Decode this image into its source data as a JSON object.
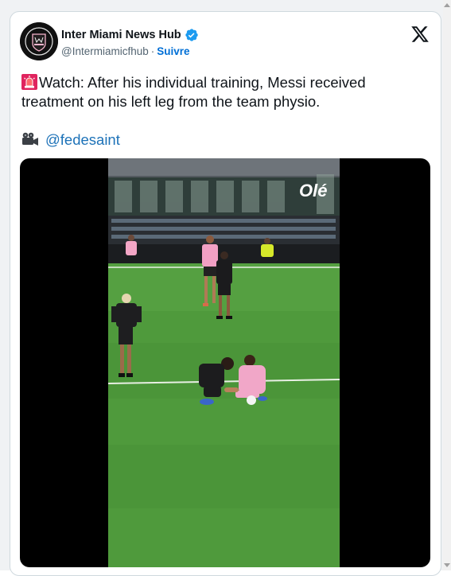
{
  "tweet": {
    "author": {
      "display_name": "Inter Miami News Hub",
      "handle": "@Intermiamicfhub",
      "separator": "·",
      "follow_label": "Suivre",
      "verified": true
    },
    "text": "Watch: After his individual training, Messi received treatment on his left leg from the team physio.",
    "credit_mention": "@fedesaint",
    "icons": {
      "lead": "siren-icon",
      "credit": "movie-camera-icon",
      "brand": "x-logo-icon",
      "badge": "verified-badge-icon"
    },
    "media": {
      "type": "video",
      "watermark": "Olé"
    }
  },
  "colors": {
    "link": "#1d72b8",
    "follow": "#006fd6",
    "verified": "#1d9bf0",
    "text": "#0f1419",
    "muted": "#536471",
    "pitch": "#4f9a3c"
  }
}
